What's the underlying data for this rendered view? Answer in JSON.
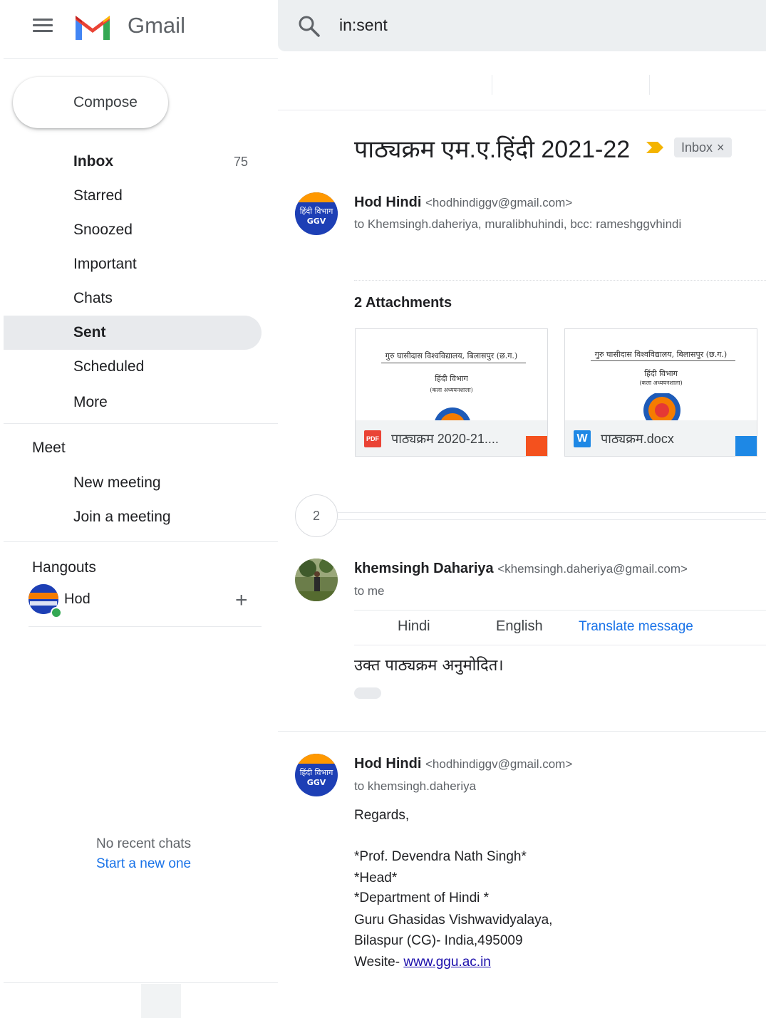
{
  "header": {
    "app_name": "Gmail",
    "search_query": "in:sent"
  },
  "sidebar": {
    "compose_label": "Compose",
    "items": [
      {
        "label": "Inbox",
        "count": "75"
      },
      {
        "label": "Starred"
      },
      {
        "label": "Snoozed"
      },
      {
        "label": "Important"
      },
      {
        "label": "Chats"
      },
      {
        "label": "Sent"
      },
      {
        "label": "Scheduled"
      },
      {
        "label": "More"
      }
    ],
    "meet": {
      "title": "Meet",
      "new_meeting": "New meeting",
      "join_meeting": "Join a meeting"
    },
    "hangouts": {
      "title": "Hangouts",
      "contact_name": "Hod",
      "no_recent": "No recent chats",
      "start_new": "Start a new one"
    }
  },
  "thread": {
    "subject": "पाठ्यक्रम एम.ए.हिंदी 2021-22",
    "label_chip": "Inbox",
    "label_chip_close": "×",
    "message1": {
      "sender_name": "Hod Hindi",
      "sender_email": "<hodhindiggv@gmail.com>",
      "to_line": "to Khemsingh.daheriya, muralibhuhindi, bcc: rameshggvhindi",
      "attachments_title": "2 Attachments",
      "attachments": [
        {
          "filename": "पाठ्यक्रम 2020-21....",
          "type_badge": "PDF",
          "preview_header": "गुरु घासीदास विश्वविद्यालय, बिलासपुर (छ.ग.)",
          "preview_dept": "हिंदी विभाग",
          "preview_sub": "(कला अध्ययनशाला)"
        },
        {
          "filename": "पाठ्यक्रम.docx",
          "type_badge": "W",
          "preview_header": "गुरु घासीदास विश्वविद्यालय, बिलासपुर (छ.ग.)",
          "preview_dept": "हिंदी विभाग",
          "preview_sub": "(कला अध्ययनशाला)"
        }
      ]
    },
    "collapsed_count": "2",
    "message2": {
      "sender_name": "khemsingh Dahariya",
      "sender_email": "<khemsingh.daheriya@gmail.com>",
      "to_line": "to me",
      "translate_from": "Hindi",
      "translate_to": "English",
      "translate_link": "Translate message",
      "body": "उक्त पाठ्यक्रम अनुमोदित।"
    },
    "message3": {
      "sender_name": "Hod Hindi",
      "sender_email": "<hodhindiggv@gmail.com>",
      "to_line": "to khemsingh.daheriya",
      "greeting": "Regards,",
      "signature": [
        "*Prof. Devendra Nath Singh*",
        "*Head*",
        "*Department of Hindi *",
        "Guru Ghasidas Vishwavidyalaya,",
        "Bilaspur (CG)- India,495009"
      ],
      "website_prefix": "Wesite- ",
      "website_link": "www.ggu.ac.in"
    },
    "avatar_text_line1": "हिंदी विभाग",
    "avatar_text_line2": "GGV"
  },
  "colors": {
    "accent_blue": "#1a73e8",
    "important_marker": "#f4b400",
    "pdf_red": "#ea4335",
    "word_blue": "#1e88e5"
  }
}
